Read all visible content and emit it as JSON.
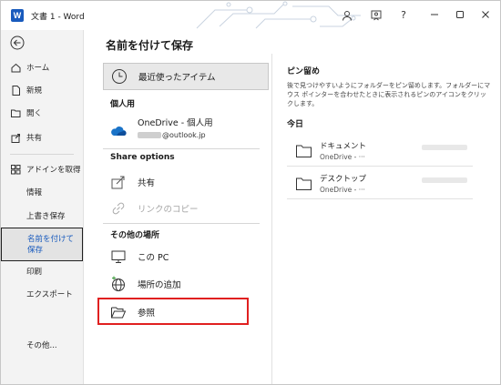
{
  "titlebar": {
    "app_icon": "W",
    "title": "文書 1  -  Word",
    "buttons": [
      "user-icon",
      "share-person-icon",
      "help-icon",
      "minimize-icon",
      "restore-icon",
      "close-icon"
    ],
    "help_label": "?"
  },
  "leftnav": {
    "back": "back-arrow-icon",
    "items": [
      {
        "label": "ホーム",
        "icon": "home-icon"
      },
      {
        "label": "新規",
        "icon": "new-document-icon"
      },
      {
        "label": "開く",
        "icon": "folder-open-icon"
      },
      {
        "label": "共有",
        "icon": "share-icon"
      },
      {
        "label": "アドインを取得",
        "icon": "addin-icon"
      },
      {
        "label": "情報"
      },
      {
        "label": "上書き保存"
      },
      {
        "label": "名前を付けて保存",
        "selected": true
      },
      {
        "label": "印刷"
      },
      {
        "label": "エクスポート"
      },
      {
        "label": "その他..."
      }
    ]
  },
  "main": {
    "title": "名前を付けて保存",
    "recent": "最近使ったアイテム",
    "personal_head": "個人用",
    "onedrive": {
      "name": "OneDrive - 個人用",
      "email": "@outlook.jp"
    },
    "share_head": "Share options",
    "share": "共有",
    "copy_link": "リンクのコピー",
    "other_head": "その他の場所",
    "this_pc": "この PC",
    "add_place": "場所の追加",
    "browse": "参照"
  },
  "right": {
    "pin_title": "ピン留め",
    "pin_desc": "後で見つけやすいようにフォルダーをピン留めします。フォルダーにマウス ポインターを合わせたときに表示されるピンのアイコンをクリックします。",
    "today_title": "今日",
    "folders": [
      {
        "name": "ドキュメント",
        "path": "OneDrive - ···"
      },
      {
        "name": "デスクトップ",
        "path": "OneDrive - ···"
      }
    ]
  },
  "colors": {
    "accent": "#185abd",
    "highlight": "#e02020",
    "nav_bg": "#f3f3f3"
  }
}
